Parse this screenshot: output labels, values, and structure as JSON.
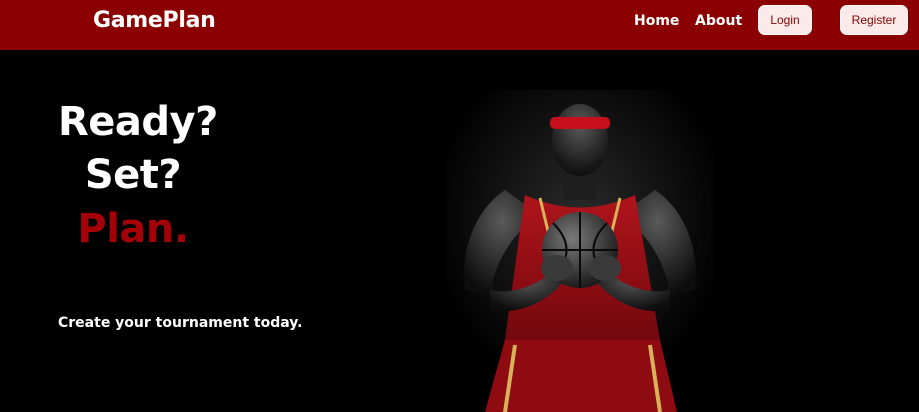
{
  "navbar": {
    "brand": "GamePlan",
    "links": {
      "home": "Home",
      "about": "About"
    },
    "buttons": {
      "login": "Login",
      "register": "Register"
    }
  },
  "hero": {
    "line1": "Ready?",
    "line2": "Set?",
    "line3": "Plan.",
    "tagline": "Create your tournament today."
  },
  "colors": {
    "navbar_bg": "#8b0000",
    "accent": "#a50008",
    "button_bg": "#fbeaea",
    "page_bg": "#000000"
  },
  "images": {
    "hero_image": "basketball-player-image"
  }
}
